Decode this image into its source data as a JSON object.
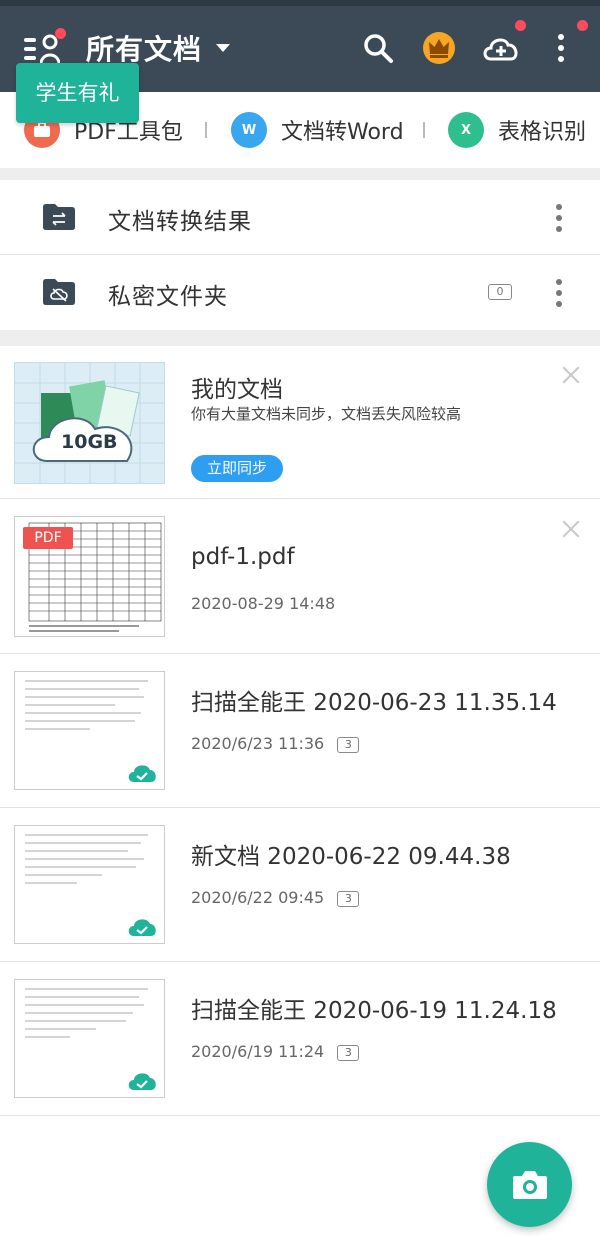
{
  "header": {
    "title": "所有文档",
    "promo_label": "学生有礼"
  },
  "tools": [
    {
      "label": "PDF工具包",
      "icon": "pdf-toolkit-icon",
      "color": "#f06a50"
    },
    {
      "label": "文档转Word",
      "icon": "word-icon",
      "color": "#3aa6f0",
      "glyph": "W"
    },
    {
      "label": "表格识别",
      "icon": "excel-icon",
      "color": "#2fbf8f",
      "glyph": "X"
    }
  ],
  "folders": [
    {
      "name": "文档转换结果"
    },
    {
      "name": "私密文件夹",
      "count": "0"
    }
  ],
  "documents": [
    {
      "title": "我的文档",
      "subtitle": "你有大量文档未同步，文档丢失风险较高",
      "button": "立即同步",
      "thumb_label": "10GB"
    },
    {
      "title": "pdf-1.pdf",
      "date": "2020-08-29  14:48",
      "thumb_tag": "PDF"
    },
    {
      "title": "扫描全能王 2020-06-23 11.35.14",
      "date": "2020/6/23 11:36",
      "pages": "3"
    },
    {
      "title": "新文档 2020-06-22 09.44.38",
      "date": "2020/6/22 09:45",
      "pages": "3"
    },
    {
      "title": "扫描全能王 2020-06-19 11.24.18",
      "date": "2020/6/19 11:24",
      "pages": "3"
    }
  ],
  "colors": {
    "topbar": "#3b4a56",
    "accent": "#1fb39a",
    "sync_button": "#2d9ef0",
    "notify_dot": "#ff4b5c",
    "premium": "#f5a623"
  }
}
